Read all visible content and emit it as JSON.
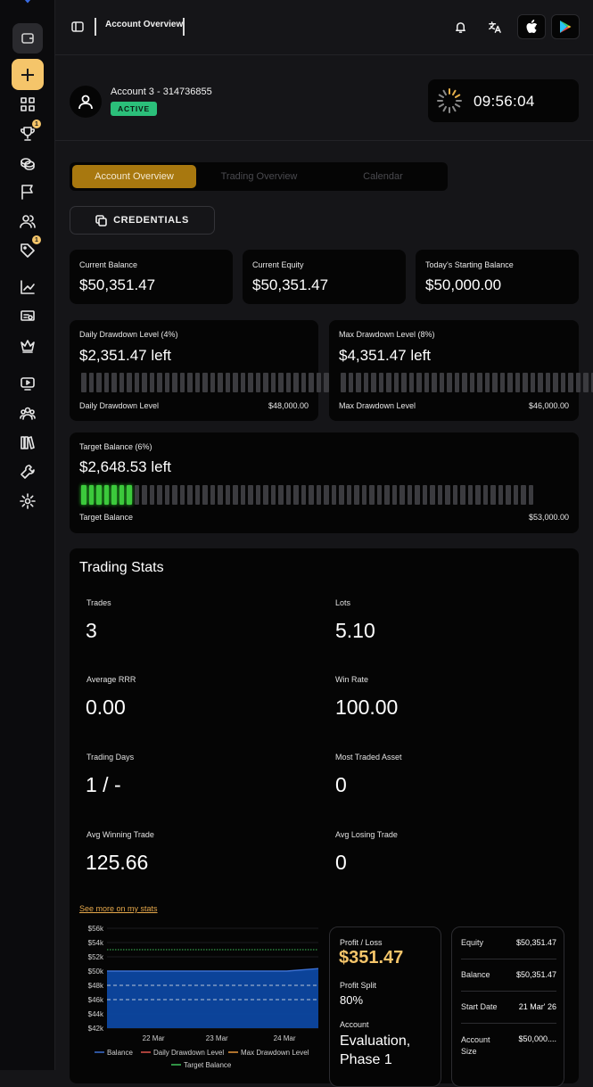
{
  "topbar": {
    "title": "Account Overview"
  },
  "account": {
    "name": "Account 3 - 314736855",
    "status": "ACTIVE",
    "time": "09:56:04"
  },
  "sidebar": {
    "badges": [
      "1",
      "1"
    ]
  },
  "tabs": [
    "Account Overview",
    "Trading Overview",
    "Calendar"
  ],
  "credentials_label": "CREDENTIALS",
  "summary": [
    {
      "label": "Current Balance",
      "value": "$50,351.47"
    },
    {
      "label": "Current Equity",
      "value": "$50,351.47"
    },
    {
      "label": "Today's Starting Balance",
      "value": "$50,000.00"
    }
  ],
  "daily_dd": {
    "label": "Daily Drawdown Level (4%)",
    "value": "$2,351.47 left",
    "foot_label": "Daily Drawdown Level",
    "foot_value": "$48,000.00",
    "filled_fraction": 0
  },
  "max_dd": {
    "label": "Max Drawdown Level (8%)",
    "value": "$4,351.47 left",
    "foot_label": "Max Drawdown Level",
    "foot_value": "$46,000.00",
    "filled_fraction": 0
  },
  "target": {
    "label": "Target Balance (6%)",
    "value": "$2,648.53 left",
    "foot_label": "Target Balance",
    "foot_value": "$53,000.00",
    "filled_fraction": 0.117
  },
  "trading_stats": {
    "title": "Trading Stats",
    "items": [
      {
        "label": "Trades",
        "value": "3"
      },
      {
        "label": "Lots",
        "value": "5.10"
      },
      {
        "label": "Average RRR",
        "value": "0.00"
      },
      {
        "label": "Win Rate",
        "value": "100.00"
      },
      {
        "label": "Trading Days",
        "value": "1 / -"
      },
      {
        "label": "Most Traded Asset",
        "value": "0"
      },
      {
        "label": "Avg Winning Trade",
        "value": "125.66"
      },
      {
        "label": "Avg Losing Trade",
        "value": "0"
      }
    ],
    "see_more": "See more on my stats"
  },
  "chart_data": {
    "type": "area",
    "x": [
      "22 Mar",
      "23 Mar",
      "24 Mar"
    ],
    "y_ticks": [
      "$42k",
      "$44k",
      "$46k",
      "$48k",
      "$50k",
      "$52k",
      "$54k",
      "$56k"
    ],
    "ylim": [
      42000,
      56000
    ],
    "series": [
      {
        "name": "Balance",
        "color": "#3b6fd1",
        "values": [
          [
            0,
            50000
          ],
          [
            0.85,
            50000
          ],
          [
            1.0,
            50351.47
          ]
        ]
      },
      {
        "name": "Daily Drawdown Level",
        "color": "#e0554d",
        "values": [
          [
            0,
            48000
          ],
          [
            1,
            48000
          ]
        ]
      },
      {
        "name": "Max Drawdown Level",
        "color": "#e8963a",
        "values": [
          [
            0,
            46000
          ],
          [
            1,
            46000
          ]
        ]
      },
      {
        "name": "Target Balance",
        "color": "#3ec25a",
        "values": [
          [
            0,
            53000
          ],
          [
            1,
            53000
          ]
        ]
      }
    ]
  },
  "profit": {
    "label": "Profit / Loss",
    "value": "$351.47",
    "split_label": "Profit Split",
    "split_value": "80%",
    "account_label": "Account",
    "account_value": "Evaluation, Phase 1"
  },
  "details": [
    {
      "label": "Equity",
      "value": "$50,351.47"
    },
    {
      "label": "Balance",
      "value": "$50,351.47"
    },
    {
      "label": "Start Date",
      "value": "21 Mar' 26"
    },
    {
      "label": "Account Size",
      "value": "$50,000...."
    }
  ],
  "colors": {
    "accent": "#f5c56a",
    "tab_active": "#a8780f",
    "badge": "#2bbf7a",
    "progress_on": "#3cc93c"
  }
}
